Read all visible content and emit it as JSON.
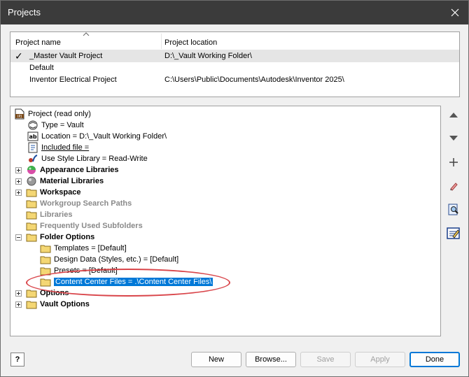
{
  "window": {
    "title": "Projects"
  },
  "project_list": {
    "columns": [
      "Project name",
      "Project location"
    ],
    "rows": [
      {
        "name": "_Master Vault Project",
        "location": "D:\\_Vault Working Folder\\",
        "active": true
      },
      {
        "name": "Default",
        "location": "",
        "active": false
      },
      {
        "name": "Inventor Electrical Project",
        "location": "C:\\Users\\Public\\Documents\\Autodesk\\Inventor 2025\\",
        "active": false
      }
    ]
  },
  "tree": {
    "root": "Project (read only)",
    "root_badge": "IPJ",
    "items": [
      "Type = Vault",
      "Location = D:\\_Vault Working Folder\\",
      "Included file =",
      "Use Style Library = Read-Write",
      "Appearance Libraries",
      "Material Libraries",
      "Workspace",
      "Workgroup Search Paths",
      "Libraries",
      "Frequently Used Subfolders",
      "Folder Options",
      "Templates = [Default]",
      "Design Data (Styles, etc.) = [Default]",
      "Presets = [Default]",
      "Content Center Files = .\\Content Center Files\\",
      "Options",
      "Vault Options"
    ],
    "icon_text": {
      "ab": "ab"
    }
  },
  "buttons": {
    "help": "?",
    "new": "New",
    "browse": "Browse...",
    "save": "Save",
    "apply": "Apply",
    "done": "Done"
  },
  "colors": {
    "selection": "#0078d7",
    "highlight_ellipse": "#d9454a",
    "titlebar": "#3b3b3b"
  }
}
